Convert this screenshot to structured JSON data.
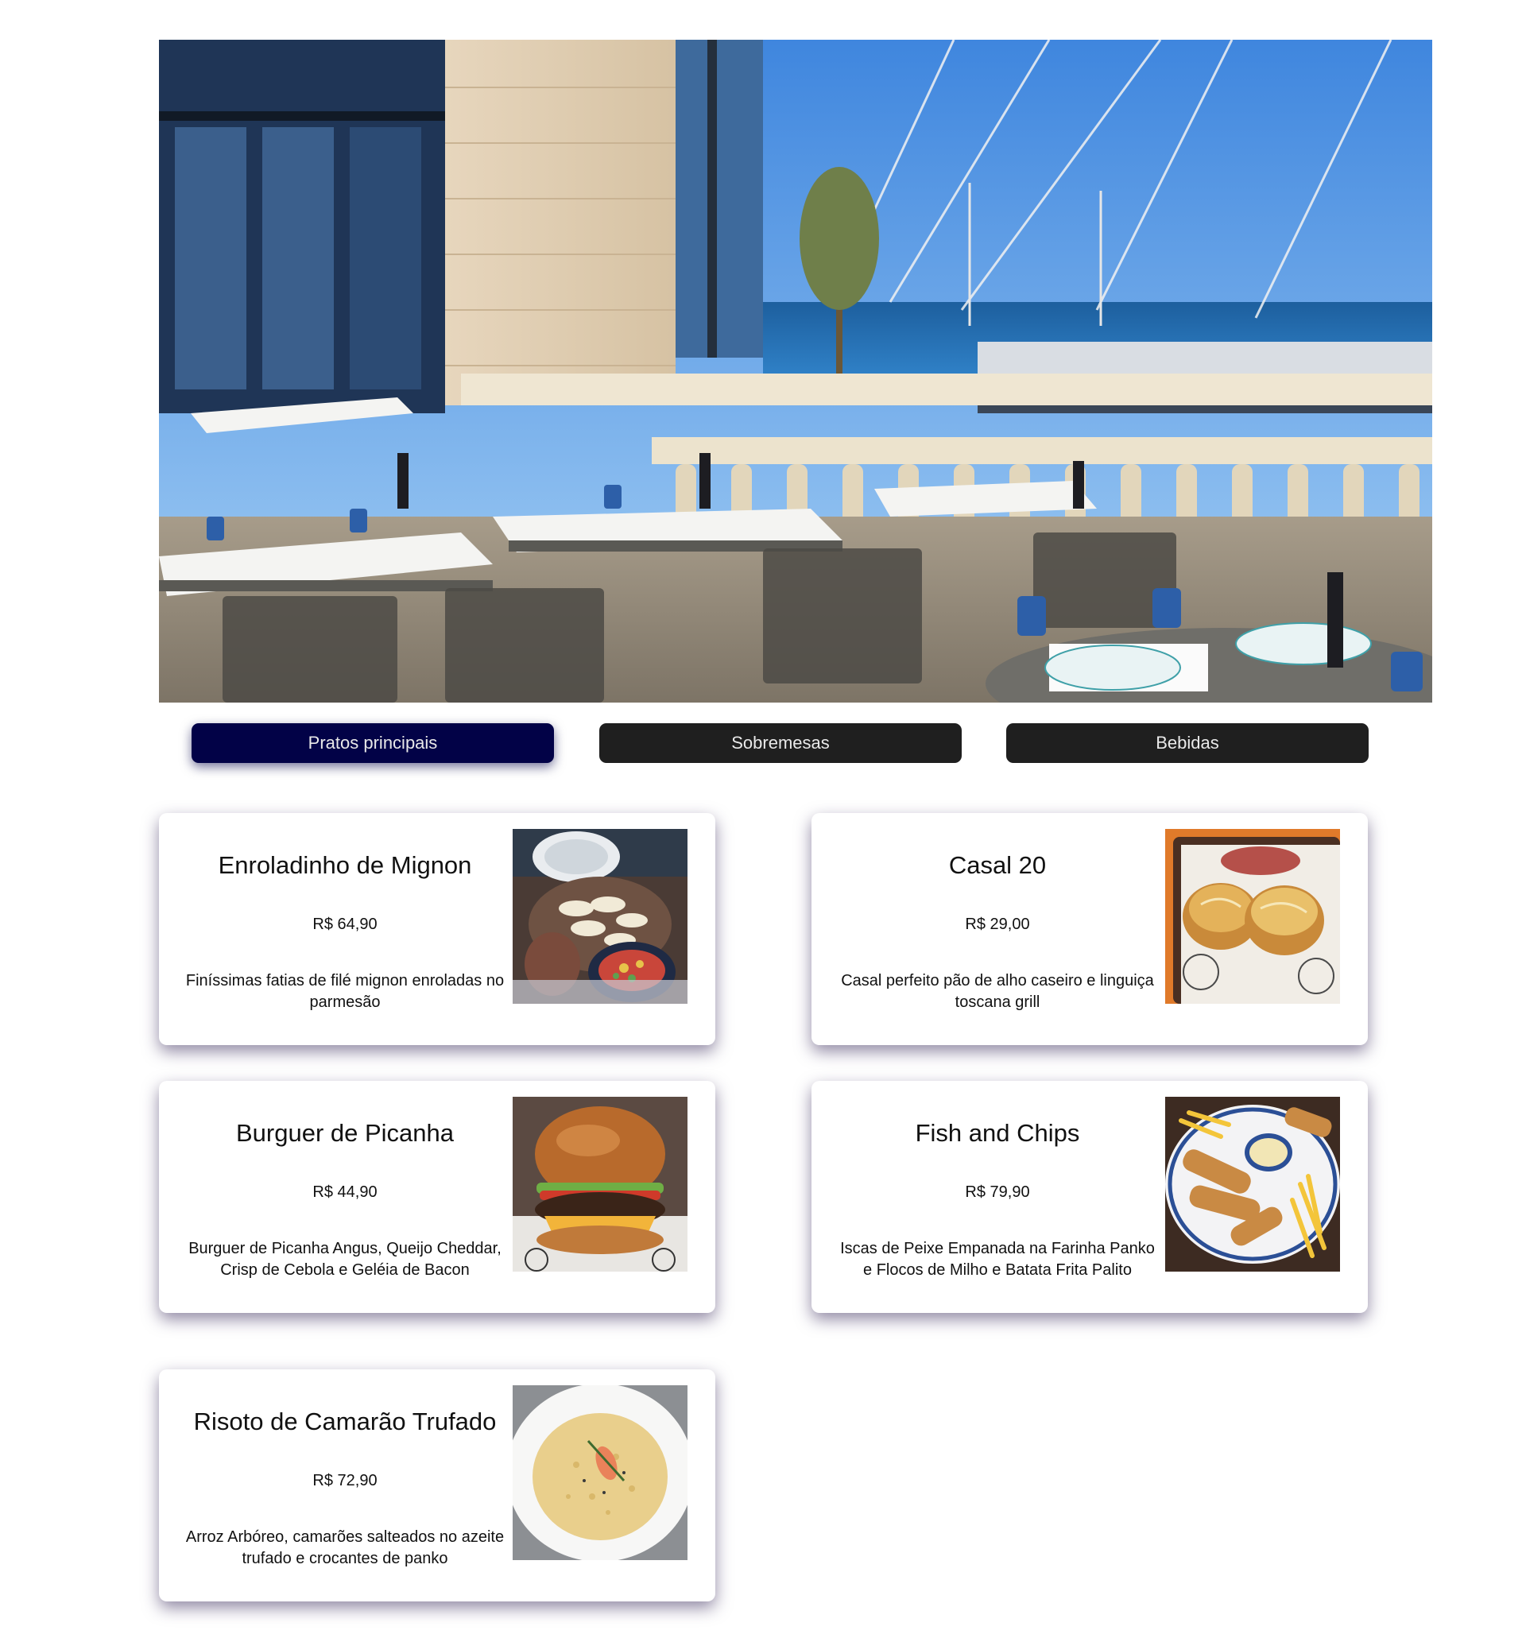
{
  "hero": {
    "image": "restaurant-terrace-sea-view"
  },
  "tabs": [
    {
      "label": "Pratos principais",
      "active": true
    },
    {
      "label": "Sobremesas",
      "active": false
    },
    {
      "label": "Bebidas",
      "active": false
    }
  ],
  "menu_items": [
    {
      "name": "Enroladinho de Mignon",
      "price": "R$ 64,90",
      "description": "Finíssimas fatias de filé mignon enroladas no parmesão",
      "image": "mignon-rolls-photo"
    },
    {
      "name": "Casal 20",
      "price": "R$ 29,00",
      "description": "Casal perfeito pão de alho caseiro e linguiça toscana grill",
      "image": "garlic-bread-sausage-photo"
    },
    {
      "name": "Burguer de Picanha",
      "price": "R$ 44,90",
      "description": "Burguer de Picanha Angus, Queijo Cheddar, Crisp de Cebola e Geléia de Bacon",
      "image": "burger-photo"
    },
    {
      "name": "Fish and Chips",
      "price": "R$ 79,90",
      "description": "Iscas de Peixe Empanada na Farinha Panko e Flocos de Milho e Batata Frita Palito",
      "image": "fish-and-chips-photo"
    },
    {
      "name": "Risoto de Camarão Trufado",
      "price": "R$ 72,90",
      "description": "Arroz Arbóreo, camarões salteados no azeite trufado e crocantes de panko",
      "image": "shrimp-risotto-photo"
    }
  ],
  "colors": {
    "active_tab": "#020247",
    "inactive_tab": "#1f1f1f",
    "tab_text": "#e9e9e9",
    "card_shadow": "#372a5a"
  }
}
